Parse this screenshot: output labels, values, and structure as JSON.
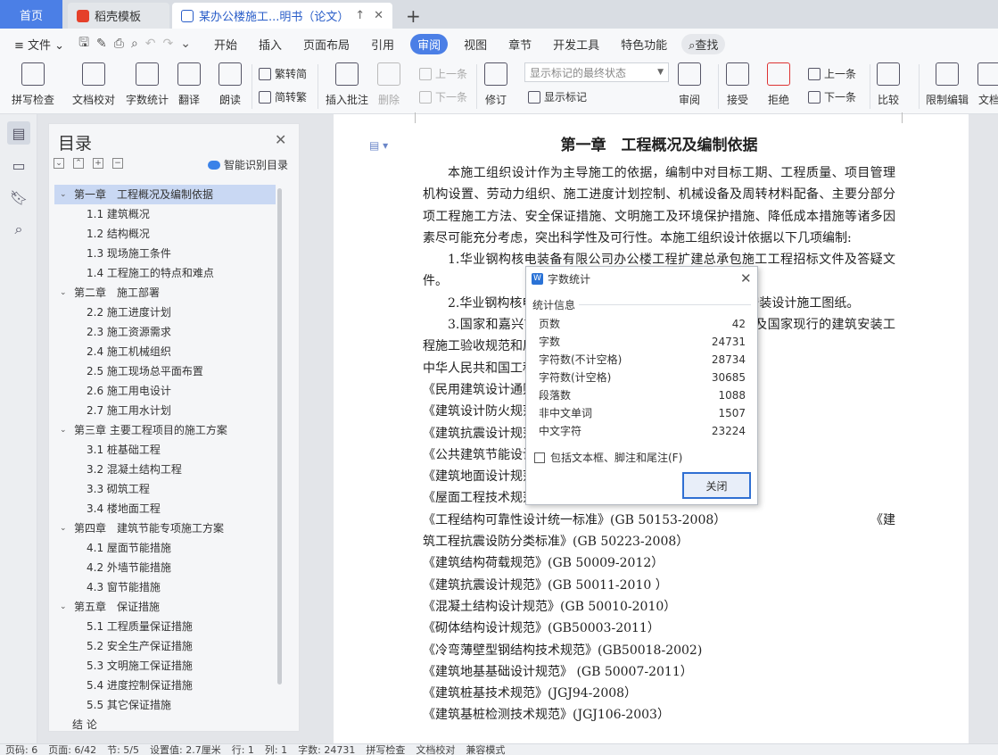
{
  "tabs": {
    "home": "首页",
    "template": "稻壳模板",
    "doc": "某办公楼施工...明书（论文）",
    "new": "+"
  },
  "menu": {
    "file": "文件",
    "items": [
      "开始",
      "插入",
      "页面布局",
      "引用",
      "审阅",
      "视图",
      "章节",
      "开发工具",
      "特色功能"
    ],
    "active": "审阅",
    "search": "查找"
  },
  "ribbon": {
    "spell": "拼写检查",
    "doc_check": "文档校对",
    "word_count": "字数统计",
    "translate": "翻译",
    "read": "朗读",
    "trad": "繁转简",
    "simp": "简转繁",
    "insert_comment": "插入批注",
    "delete": "删除",
    "prev": "上一条",
    "next": "下一条",
    "revise": "修订",
    "mark_state": "显示标记的最终状态",
    "show_mark": "显示标记",
    "review": "审阅",
    "accept": "接受",
    "reject": "拒绝",
    "prev2": "上一条",
    "next2": "下一条",
    "compare": "比较",
    "restrict": "限制编辑",
    "doc_perm": "文档"
  },
  "toc": {
    "title": "目录",
    "smart": "智能识别目录",
    "items": [
      {
        "t": "第一章　工程概况及编制依据",
        "lvl": 1,
        "hl": true
      },
      {
        "t": "1.1  建筑概况",
        "lvl": 2
      },
      {
        "t": "1.2  结构概况",
        "lvl": 2
      },
      {
        "t": "1.3  现场施工条件",
        "lvl": 2
      },
      {
        "t": "1.4  工程施工的特点和难点",
        "lvl": 2
      },
      {
        "t": "第二章　施工部署",
        "lvl": 1
      },
      {
        "t": "2.2  施工进度计划",
        "lvl": 2
      },
      {
        "t": "2.3  施工资源需求",
        "lvl": 2
      },
      {
        "t": "2.4  施工机械组织",
        "lvl": 2
      },
      {
        "t": "2.5  施工现场总平面布置",
        "lvl": 2
      },
      {
        "t": "2.6  施工用电设计",
        "lvl": 2
      },
      {
        "t": "2.7  施工用水计划",
        "lvl": 2
      },
      {
        "t": "第三章  主要工程项目的施工方案",
        "lvl": 1
      },
      {
        "t": "3.1  桩基础工程",
        "lvl": 2
      },
      {
        "t": "3.2  混凝土结构工程",
        "lvl": 2
      },
      {
        "t": "3.3  砌筑工程",
        "lvl": 2
      },
      {
        "t": "3.4  楼地面工程",
        "lvl": 2
      },
      {
        "t": "第四章　建筑节能专项施工方案",
        "lvl": 1
      },
      {
        "t": "4.1  屋面节能措施",
        "lvl": 2
      },
      {
        "t": "4.2  外墙节能措施",
        "lvl": 2
      },
      {
        "t": "4.3  窗节能措施",
        "lvl": 2
      },
      {
        "t": "第五章　保证措施",
        "lvl": 1
      },
      {
        "t": "5.1  工程质量保证措施",
        "lvl": 2
      },
      {
        "t": "5.2  安全生产保证措施",
        "lvl": 2
      },
      {
        "t": "5.3  文明施工保证措施",
        "lvl": 2
      },
      {
        "t": "5.4  进度控制保证措施",
        "lvl": 2
      },
      {
        "t": "5.5  其它保证措施",
        "lvl": 2
      },
      {
        "t": "结  论",
        "lvl": 3
      }
    ]
  },
  "doc": {
    "heading": "第一章　工程概况及编制依据",
    "p1": "本施工组织设计作为主导施工的依据，编制中对目标工期、工程质量、项目管理机构设置、劳动力组织、施工进度计划控制、机械设备及周转材料配备、主要分部分项工程施工方法、安全保证措施、文明施工及环境保护措施、降低成本措施等诸多因素尽可能充分考虑，突出科学性及可行性。本施工组织设计依据以下几项编制:",
    "p2": "1.华业钢构核电装备有限公司办公楼工程扩建总承包施工工程招标文件及答疑文件。",
    "p3": "2.华业钢构核电装备有限公司办公楼工程建筑、结构、安装设计施工图纸。",
    "p4": "3.国家和嘉兴市现行的建筑施工技术规范、规程、标准及国家现行的建筑安装工程施工验收规范和质量评定标准。",
    "p5": "中华人民共和国工程建设标准强制性条文",
    "refs": [
      "《民用建筑设计通则》(GB50352-2005)",
      "《建筑设计防火规范》(GB50016-2006)",
      "《建筑抗震设计规范》(GB50011-2010)",
      "《公共建筑节能设计标准》(GB50189-2005)",
      "《建筑地面设计规范》(GB50037-96)",
      "《屋面工程技术规范》(GB50345-2012)"
    ],
    "ref_split_left": "《工程结构可靠性设计统一标准》(GB 50153-2008）",
    "ref_split_right": "《建",
    "refs2": [
      "筑工程抗震设防分类标准》(GB 50223-2008）",
      "《建筑结构荷载规范》(GB 50009-2012）",
      "《建筑抗震设计规范》(GB 50011-2010  ）",
      "《混凝土结构设计规范》(GB 50010-2010）",
      "《砌体结构设计规范》(GB50003-2011）",
      "《冷弯薄壁型钢结构技术规范》(GB50018-2002)",
      "《建筑地基基础设计规范》 (GB 50007-2011）",
      "《建筑桩基技术规范》(JGJ94-2008）",
      "《建筑基桩检测技术规范》(JGJ106-2003）"
    ]
  },
  "dialog": {
    "title": "字数统计",
    "group": "统计信息",
    "rows": [
      {
        "k": "页数",
        "v": "42"
      },
      {
        "k": "字数",
        "v": "24731"
      },
      {
        "k": "字符数(不计空格)",
        "v": "28734"
      },
      {
        "k": "字符数(计空格)",
        "v": "30685"
      },
      {
        "k": "段落数",
        "v": "1088"
      },
      {
        "k": "非中文单词",
        "v": "1507"
      },
      {
        "k": "中文字符",
        "v": "23224"
      }
    ],
    "checkbox": "包括文本框、脚注和尾注(F)",
    "close": "关闭"
  },
  "status": {
    "items": [
      "页码: 6",
      "页面: 6/42",
      "节: 5/5",
      "设置值: 2.7厘米",
      "行: 1",
      "列: 1",
      "字数: 24731",
      "拼写检查",
      "文档校对",
      "兼容模式"
    ]
  }
}
